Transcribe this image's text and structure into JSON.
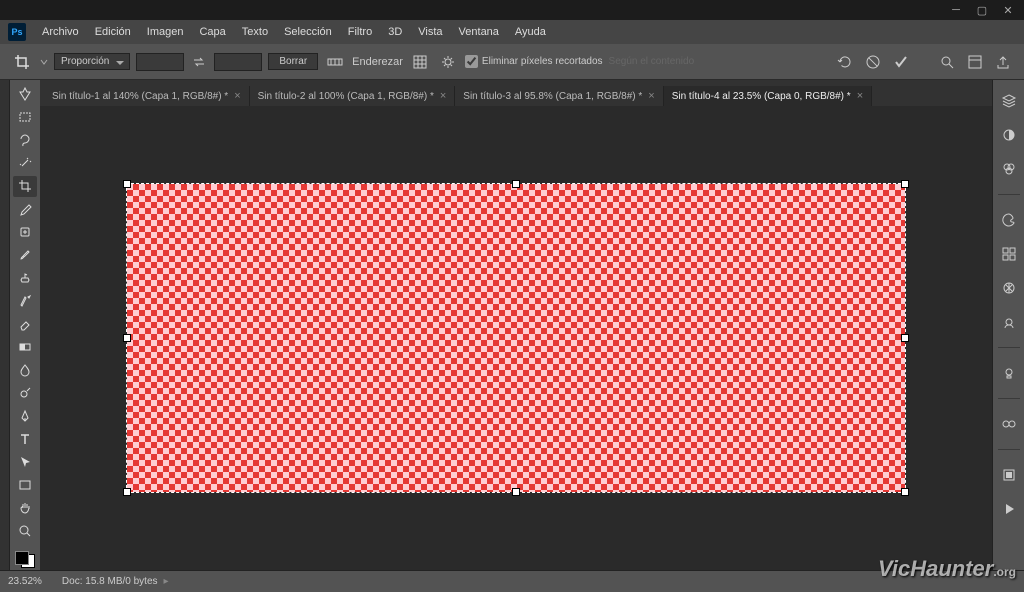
{
  "app": {
    "logo_text": "Ps"
  },
  "window_controls": {
    "min": "─",
    "max": "▢",
    "close": "✕"
  },
  "menu": [
    {
      "label": "Archivo",
      "ul": "A"
    },
    {
      "label": "Edición",
      "ul": "E"
    },
    {
      "label": "Imagen",
      "ul": "I"
    },
    {
      "label": "Capa",
      "ul": "C"
    },
    {
      "label": "Texto",
      "ul": "T"
    },
    {
      "label": "Selección",
      "ul": "S"
    },
    {
      "label": "Filtro",
      "ul": "F"
    },
    {
      "label": "3D",
      "ul": "3"
    },
    {
      "label": "Vista",
      "ul": "V"
    },
    {
      "label": "Ventana",
      "ul": "n"
    },
    {
      "label": "Ayuda",
      "ul": "A"
    }
  ],
  "options": {
    "tool_icon": "crop-tool-icon",
    "ratio_label": "Proporción",
    "width_value": "",
    "height_value": "",
    "clear_btn": "Borrar",
    "straighten_btn": "Enderezar",
    "delete_cropped_label": "Eliminar píxeles recortados",
    "content_aware_label": "Según el contenido"
  },
  "tabs": [
    {
      "label": "Sin título-1 al 140% (Capa 1, RGB/8#) *",
      "active": false
    },
    {
      "label": "Sin título-2 al 100% (Capa 1, RGB/8#) *",
      "active": false
    },
    {
      "label": "Sin título-3 al 95.8% (Capa 1, RGB/8#) *",
      "active": false
    },
    {
      "label": "Sin título-4 al 23.5% (Capa 0, RGB/8#) *",
      "active": true
    }
  ],
  "tools": [
    "move-tool",
    "rectangular-marquee-tool",
    "lasso-tool",
    "magic-wand-tool",
    "crop-tool",
    "eyedropper-tool",
    "healing-brush-tool",
    "brush-tool",
    "clone-stamp-tool",
    "history-brush-tool",
    "eraser-tool",
    "gradient-tool",
    "blur-tool",
    "dodge-tool",
    "pen-tool",
    "type-tool",
    "path-selection-tool",
    "rectangle-tool",
    "hand-tool",
    "zoom-tool"
  ],
  "right_panels": [
    "layers-icon",
    "adjustments-icon",
    "channels-icon",
    "color-icon",
    "swatches-icon",
    "gradient-panel-icon",
    "styles-icon",
    "light-icon",
    "cc-libraries-icon",
    "actions-icon",
    "play-icon"
  ],
  "status": {
    "zoom": "23.52%",
    "doc_info": "Doc: 15.8 MB/0 bytes"
  },
  "watermark": {
    "main": "VicHaunter",
    "suffix": ".org"
  },
  "canvas": {
    "fill_pattern": "red-transparency-checker",
    "primary_color": "#e53935",
    "secondary_color": "#ffcdd2"
  }
}
